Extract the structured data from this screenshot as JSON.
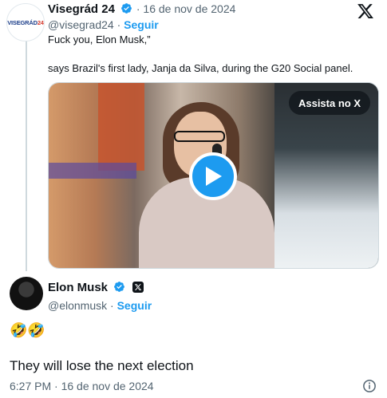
{
  "tweet": {
    "avatar_text": "VISEGRÁD",
    "avatar_text_accent": "24",
    "author_name": "Visegrád 24",
    "date": "· 16 de nov de 2024",
    "handle": "@visegrad24",
    "follow_label": "Seguir",
    "text_line1": "Fuck you, Elon Musk,”",
    "text_line2": "says Brazil's first lady, Janja da Silva, during the G20 Social panel.",
    "media_overlay_label": "Assista no X"
  },
  "reply": {
    "author_name": "Elon Musk",
    "handle": "@elonmusk",
    "follow_label": "Seguir",
    "emoji": "🤣🤣",
    "text": "They will lose the next election",
    "timestamp": "6:27 PM · 16 de nov de 2024"
  },
  "colors": {
    "accent": "#1d9bf0",
    "text": "#0f1419",
    "muted": "#536471"
  },
  "icons": [
    "verified-icon",
    "x-logo-icon",
    "play-icon",
    "x-badge-icon",
    "info-icon"
  ]
}
